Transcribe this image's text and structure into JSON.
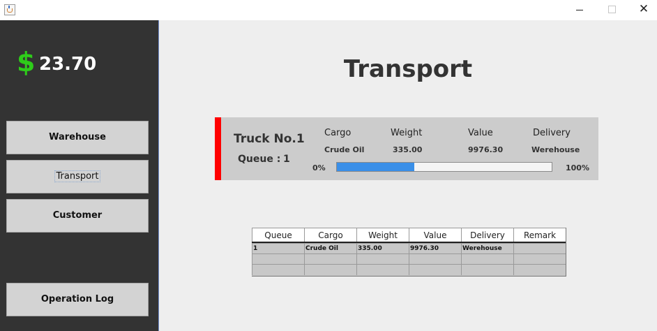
{
  "window": {
    "title": "",
    "controls": {
      "minimize": "—",
      "maximize": "□",
      "close": "✕"
    }
  },
  "sidebar": {
    "balance": {
      "symbol": "$",
      "amount": "23.70",
      "symbol_color": "#2ecc1a"
    },
    "nav": {
      "warehouse": "Warehouse",
      "transport": "Transport",
      "customer": "Customer",
      "operation_log": "Operation Log"
    }
  },
  "main": {
    "title": "Transport",
    "truck_card": {
      "name": "Truck No.1",
      "queue_label": "Queue :",
      "queue_value": "1",
      "headers": {
        "cargo": "Cargo",
        "weight": "Weight",
        "value": "Value",
        "delivery": "Delivery"
      },
      "values": {
        "cargo": "Crude Oil",
        "weight": "335.00",
        "value": "9976.30",
        "delivery": "Werehouse"
      },
      "progress": {
        "min_label": "0%",
        "max_label": "100%",
        "fraction": 0.36
      },
      "accent_color": "#ff0000",
      "progress_color": "#3a8fe8"
    },
    "table": {
      "columns": [
        "Queue",
        "Cargo",
        "Weight",
        "Value",
        "Delivery",
        "Remark"
      ],
      "rows": [
        [
          "1",
          "Crude Oil",
          "335.00",
          "9976.30",
          "Werehouse",
          ""
        ],
        [
          "",
          "",
          "",
          "",
          "",
          ""
        ],
        [
          "",
          "",
          "",
          "",
          "",
          ""
        ]
      ]
    }
  }
}
